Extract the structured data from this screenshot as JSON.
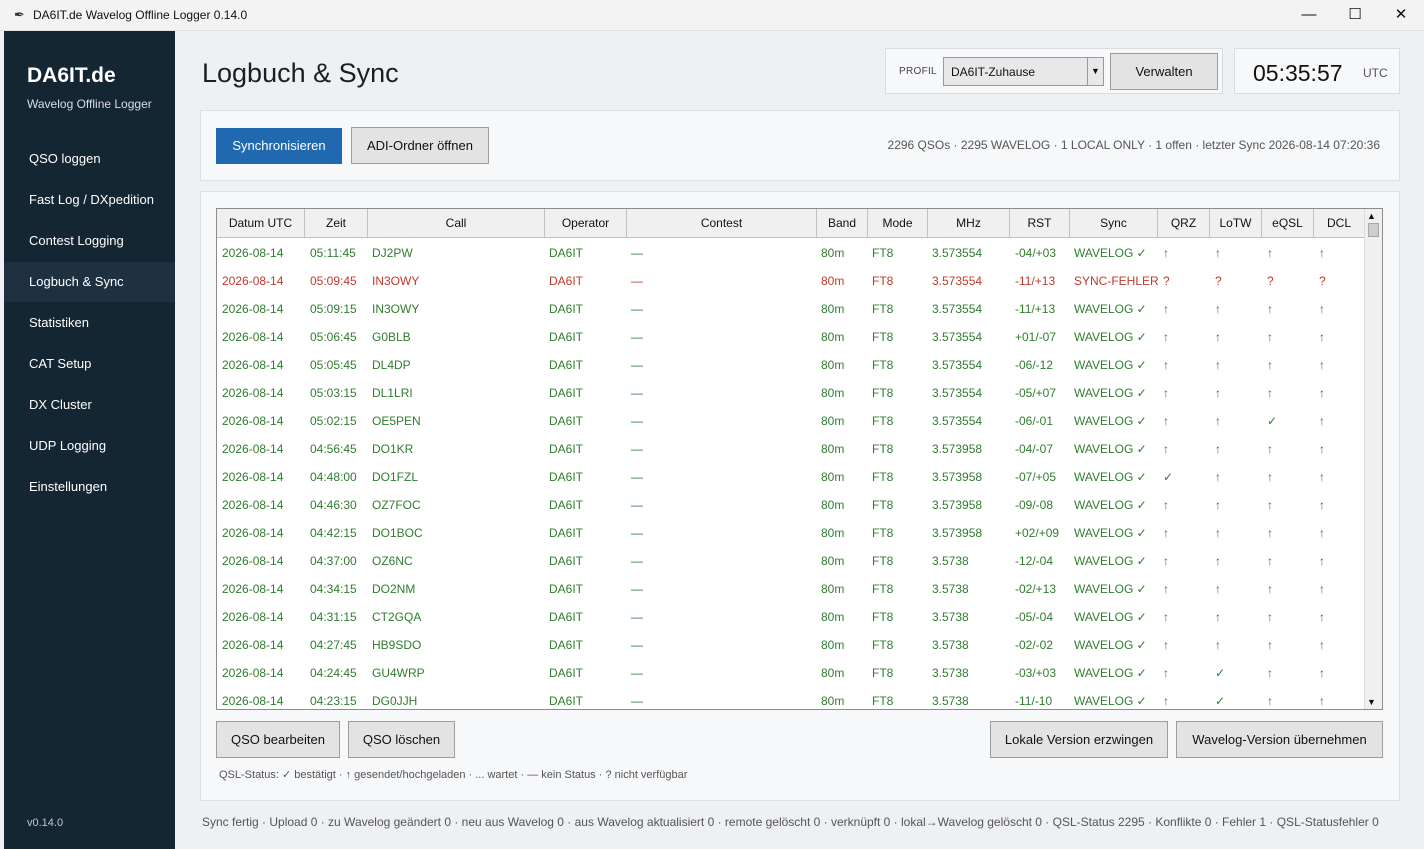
{
  "window": {
    "title": "DA6IT.de Wavelog Offline Logger 0.14.0"
  },
  "sidebar": {
    "brand": "DA6IT.de",
    "subtitle": "Wavelog Offline Logger",
    "items": [
      {
        "label": "QSO loggen"
      },
      {
        "label": "Fast Log / DXpedition"
      },
      {
        "label": "Contest Logging"
      },
      {
        "label": "Logbuch & Sync"
      },
      {
        "label": "Statistiken"
      },
      {
        "label": "CAT Setup"
      },
      {
        "label": "DX Cluster"
      },
      {
        "label": "UDP Logging"
      },
      {
        "label": "Einstellungen"
      }
    ],
    "active_index": 3,
    "version": "v0.14.0"
  },
  "header": {
    "title": "Logbuch & Sync",
    "profile_label": "PROFIL",
    "profile_value": "DA6IT-Zuhause",
    "manage_label": "Verwalten",
    "clock": "05:35:57",
    "clock_tz": "UTC"
  },
  "toolbar": {
    "sync_label": "Synchronisieren",
    "adi_label": "ADI-Ordner öffnen",
    "summary": "2296 QSOs · 2295 WAVELOG · 1 LOCAL ONLY · 1 offen · letzter Sync 2026-08-14 07:20:36"
  },
  "table": {
    "columns": [
      "Datum UTC",
      "Zeit",
      "Call",
      "Operator",
      "Contest",
      "Band",
      "Mode",
      "MHz",
      "RST",
      "Sync",
      "QRZ",
      "LoTW",
      "eQSL",
      "DCL"
    ],
    "rows": [
      {
        "status": "ok",
        "cells": [
          "2026-08-14",
          "05:11:45",
          "DJ2PW",
          "DA6IT",
          "—",
          "80m",
          "FT8",
          "3.573554",
          "-04/+03",
          "WAVELOG ✓",
          "↑",
          "↑",
          "↑",
          "↑"
        ]
      },
      {
        "status": "err",
        "cells": [
          "2026-08-14",
          "05:09:45",
          "IN3OWY",
          "DA6IT",
          "—",
          "80m",
          "FT8",
          "3.573554",
          "-11/+13",
          "SYNC-FEHLER",
          "?",
          "?",
          "?",
          "?"
        ]
      },
      {
        "status": "ok",
        "cells": [
          "2026-08-14",
          "05:09:15",
          "IN3OWY",
          "DA6IT",
          "—",
          "80m",
          "FT8",
          "3.573554",
          "-11/+13",
          "WAVELOG ✓",
          "↑",
          "↑",
          "↑",
          "↑"
        ]
      },
      {
        "status": "ok",
        "cells": [
          "2026-08-14",
          "05:06:45",
          "G0BLB",
          "DA6IT",
          "—",
          "80m",
          "FT8",
          "3.573554",
          "+01/-07",
          "WAVELOG ✓",
          "↑",
          "↑",
          "↑",
          "↑"
        ]
      },
      {
        "status": "ok",
        "cells": [
          "2026-08-14",
          "05:05:45",
          "DL4DP",
          "DA6IT",
          "—",
          "80m",
          "FT8",
          "3.573554",
          "-06/-12",
          "WAVELOG ✓",
          "↑",
          "↑",
          "↑",
          "↑"
        ]
      },
      {
        "status": "ok",
        "cells": [
          "2026-08-14",
          "05:03:15",
          "DL1LRI",
          "DA6IT",
          "—",
          "80m",
          "FT8",
          "3.573554",
          "-05/+07",
          "WAVELOG ✓",
          "↑",
          "↑",
          "↑",
          "↑"
        ]
      },
      {
        "status": "ok",
        "cells": [
          "2026-08-14",
          "05:02:15",
          "OE5PEN",
          "DA6IT",
          "—",
          "80m",
          "FT8",
          "3.573554",
          "-06/-01",
          "WAVELOG ✓",
          "↑",
          "↑",
          "✓",
          "↑"
        ]
      },
      {
        "status": "ok",
        "cells": [
          "2026-08-14",
          "04:56:45",
          "DO1KR",
          "DA6IT",
          "—",
          "80m",
          "FT8",
          "3.573958",
          "-04/-07",
          "WAVELOG ✓",
          "↑",
          "↑",
          "↑",
          "↑"
        ]
      },
      {
        "status": "ok",
        "cells": [
          "2026-08-14",
          "04:48:00",
          "DO1FZL",
          "DA6IT",
          "—",
          "80m",
          "FT8",
          "3.573958",
          "-07/+05",
          "WAVELOG ✓",
          "✓",
          "↑",
          "↑",
          "↑"
        ]
      },
      {
        "status": "ok",
        "cells": [
          "2026-08-14",
          "04:46:30",
          "OZ7FOC",
          "DA6IT",
          "—",
          "80m",
          "FT8",
          "3.573958",
          "-09/-08",
          "WAVELOG ✓",
          "↑",
          "↑",
          "↑",
          "↑"
        ]
      },
      {
        "status": "ok",
        "cells": [
          "2026-08-14",
          "04:42:15",
          "DO1BOC",
          "DA6IT",
          "—",
          "80m",
          "FT8",
          "3.573958",
          "+02/+09",
          "WAVELOG ✓",
          "↑",
          "↑",
          "↑",
          "↑"
        ]
      },
      {
        "status": "ok",
        "cells": [
          "2026-08-14",
          "04:37:00",
          "OZ6NC",
          "DA6IT",
          "—",
          "80m",
          "FT8",
          "3.5738",
          "-12/-04",
          "WAVELOG ✓",
          "↑",
          "↑",
          "↑",
          "↑"
        ]
      },
      {
        "status": "ok",
        "cells": [
          "2026-08-14",
          "04:34:15",
          "DO2NM",
          "DA6IT",
          "—",
          "80m",
          "FT8",
          "3.5738",
          "-02/+13",
          "WAVELOG ✓",
          "↑",
          "↑",
          "↑",
          "↑"
        ]
      },
      {
        "status": "ok",
        "cells": [
          "2026-08-14",
          "04:31:15",
          "CT2GQA",
          "DA6IT",
          "—",
          "80m",
          "FT8",
          "3.5738",
          "-05/-04",
          "WAVELOG ✓",
          "↑",
          "↑",
          "↑",
          "↑"
        ]
      },
      {
        "status": "ok",
        "cells": [
          "2026-08-14",
          "04:27:45",
          "HB9SDO",
          "DA6IT",
          "—",
          "80m",
          "FT8",
          "3.5738",
          "-02/-02",
          "WAVELOG ✓",
          "↑",
          "↑",
          "↑",
          "↑"
        ]
      },
      {
        "status": "ok",
        "cells": [
          "2026-08-14",
          "04:24:45",
          "GU4WRP",
          "DA6IT",
          "—",
          "80m",
          "FT8",
          "3.5738",
          "-03/+03",
          "WAVELOG ✓",
          "↑",
          "✓",
          "↑",
          "↑"
        ]
      },
      {
        "status": "ok",
        "cells": [
          "2026-08-14",
          "04:23:15",
          "DG0JJH",
          "DA6IT",
          "—",
          "80m",
          "FT8",
          "3.5738",
          "-11/-10",
          "WAVELOG ✓",
          "↑",
          "✓",
          "↑",
          "↑"
        ]
      }
    ]
  },
  "actions": {
    "edit_label": "QSO bearbeiten",
    "delete_label": "QSO löschen",
    "force_local_label": "Lokale Version erzwingen",
    "take_wavelog_label": "Wavelog-Version übernehmen"
  },
  "legend": "QSL-Status: ✓ bestätigt · ↑ gesendet/hochgeladen · ... wartet · — kein Status · ? nicht verfügbar",
  "statusbar": "Sync fertig · Upload 0 · zu Wavelog geändert 0 · neu aus Wavelog 0 · aus Wavelog aktualisiert 0 · remote gelöscht 0 · verknüpft 0 · lokal→Wavelog gelöscht 0 · QSL-Status 2295 · Konflikte 0 · Fehler 1 · QSL-Statusfehler 0",
  "colors": {
    "ok": "#2f7d2f",
    "error": "#c0392b",
    "primary": "#2068b0",
    "sidebar": "#152633"
  }
}
